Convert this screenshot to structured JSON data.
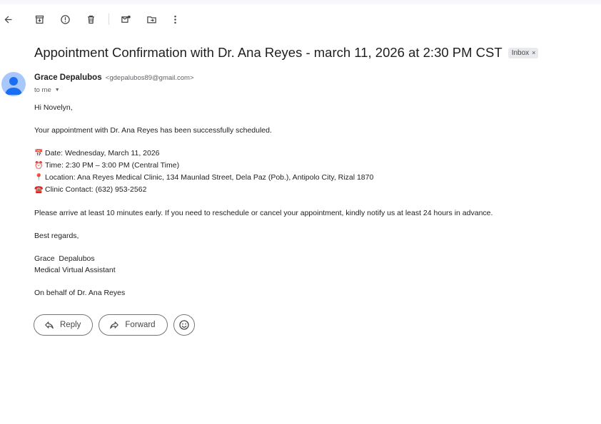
{
  "toolbar": {
    "items": [
      "back-icon",
      "archive-icon",
      "report-spam-icon",
      "delete-icon",
      "mark-unread-icon",
      "move-to-icon",
      "more-options-icon"
    ]
  },
  "email": {
    "subject": "Appointment Confirmation with Dr. Ana Reyes - march 11, 2026 at 2:30 PM CST",
    "label": "Inbox",
    "label_close": "×",
    "sender_name": "Grace Depalubos",
    "sender_email": "<gdepalubos89@gmail.com>",
    "recipient": "to me",
    "body": {
      "greeting": "Hi Novelyn,",
      "intro": "Your appointment with Dr. Ana Reyes has been successfully scheduled.",
      "date": "Date: Wednesday, March 11, 2026",
      "time": "Time: 2:30 PM – 3:00 PM (Central Time)",
      "location": "Location: Ana Reyes Medical Clinic, 134 Maunlad Street, Dela Paz (Pob.), Antipolo City, Rizal 1870",
      "contact": "Clinic Contact: (632) 953-2562",
      "instructions": "Please arrive at least 10 minutes early. If you need to reschedule or cancel your appointment, kindly notify us at least 24 hours in advance.",
      "closing": "Best regards,",
      "signature_name": "Grace  Depalubos",
      "signature_title": "Medical Virtual Assistant",
      "behalf": "On behalf of Dr. Ana Reyes"
    }
  },
  "icons": {
    "date": "📅",
    "time": "⏰",
    "location": "📍",
    "contact": "☎️"
  },
  "actions": {
    "reply": "Reply",
    "forward": "Forward"
  },
  "colors": {
    "avatar_bg": "#a8c7fa",
    "avatar_fg": "#1b6ef3"
  }
}
